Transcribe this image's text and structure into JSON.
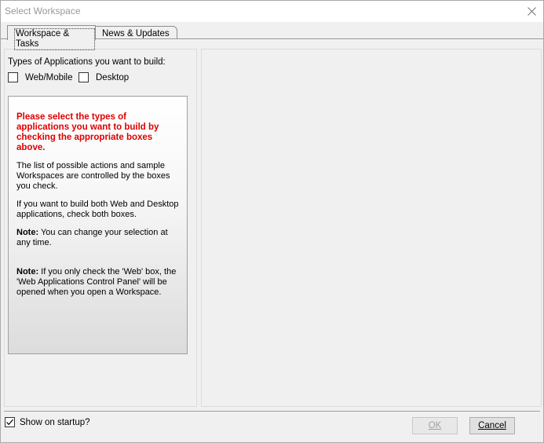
{
  "window": {
    "title": "Select Workspace"
  },
  "tabs": [
    {
      "label": "Workspace & Tasks",
      "active": true
    },
    {
      "label": "News & Updates",
      "active": false
    }
  ],
  "left": {
    "types_label": "Types of Applications you want to build:",
    "checkboxes": [
      {
        "label": "Web/Mobile",
        "checked": false
      },
      {
        "label": "Desktop",
        "checked": false
      }
    ],
    "info": {
      "warning": "Please select the types of applications you want to build by checking the appropriate boxes above.",
      "para1": "The list of possible actions and sample Workspaces are controlled by the boxes you check.",
      "para2": "If you want to build both Web and Desktop applications, check both boxes.",
      "note1_label": "Note:",
      "note1_text": " You can change your selection at any time.",
      "note2_label": "Note:",
      "note2_text": " If you only check the 'Web' box, the 'Web Applications Control Panel' will be opened when you open a Workspace."
    }
  },
  "footer": {
    "startup_label": "Show on startup?",
    "startup_checked": true,
    "ok_label": "OK",
    "ok_enabled": false,
    "cancel_label": "Cancel"
  }
}
